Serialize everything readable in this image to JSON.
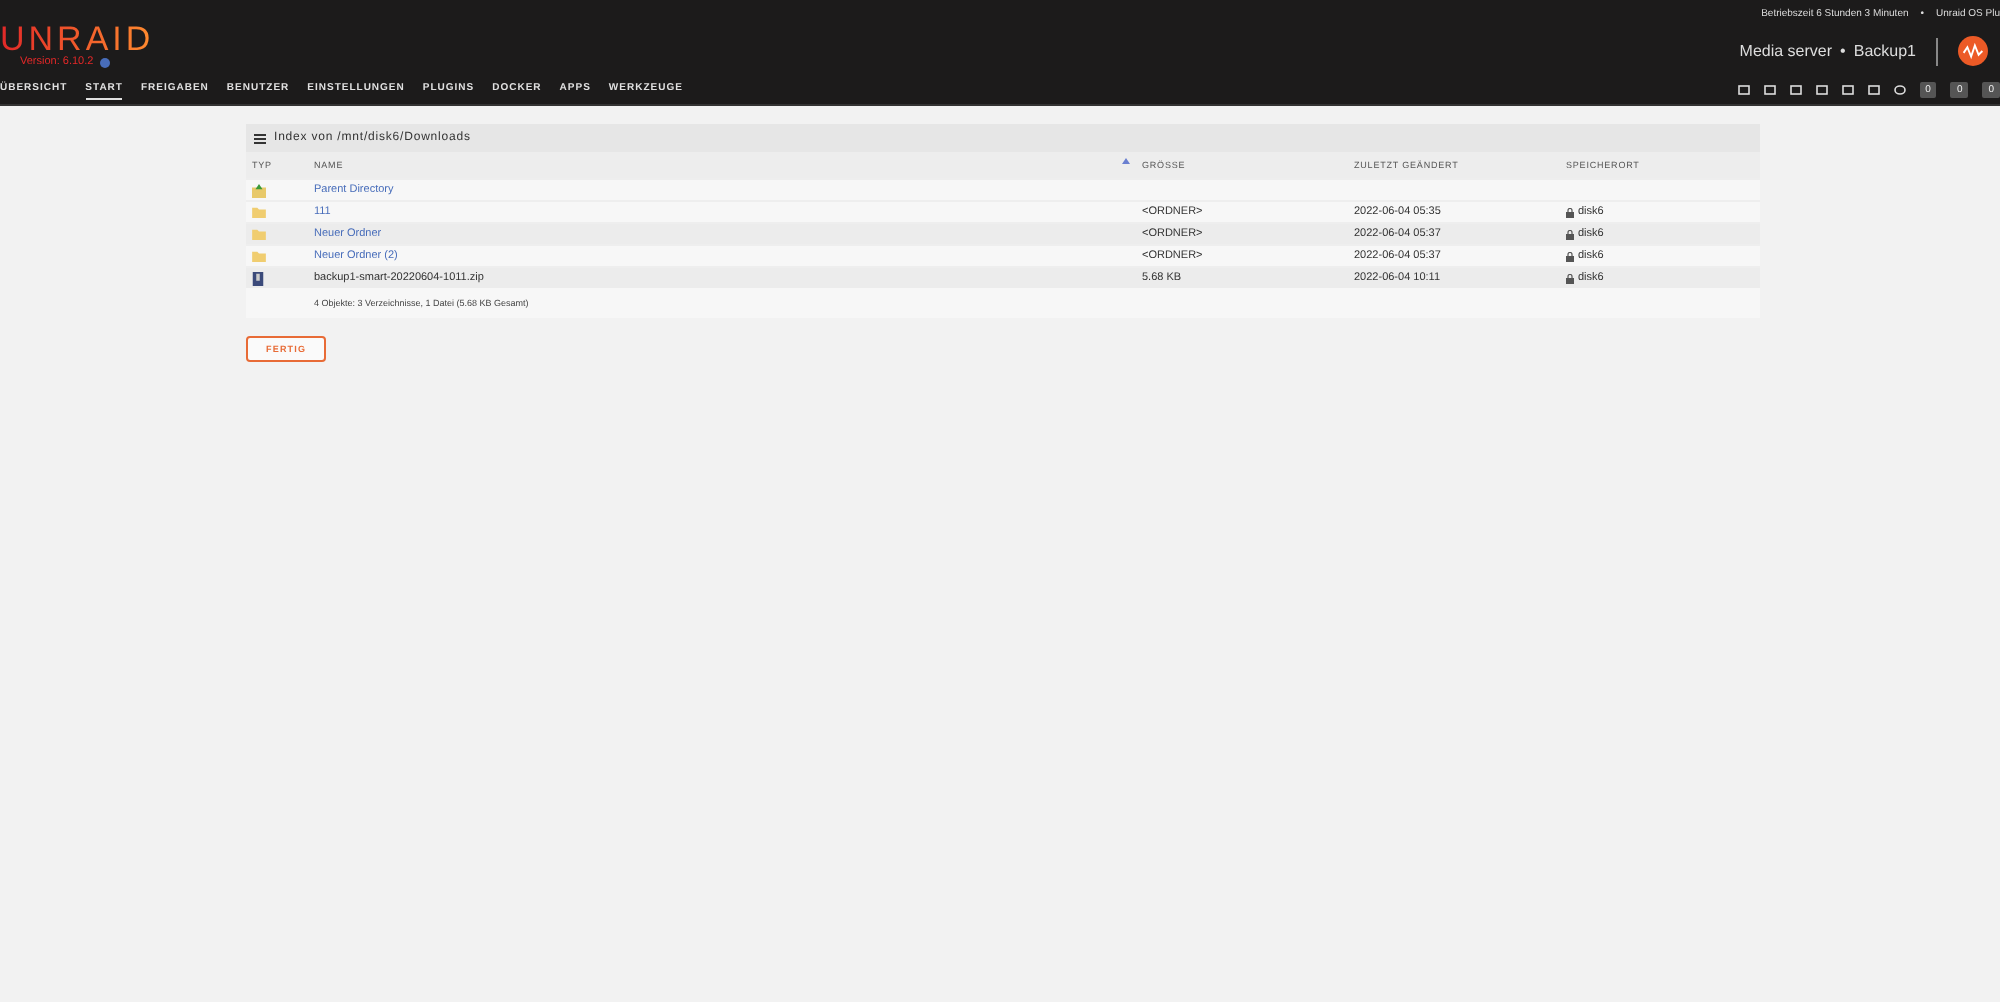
{
  "header": {
    "logo": "UNRAID",
    "version": "Version: 6.10.2",
    "status": [
      "Betriebszeit 6 Stunden 3 Minuten",
      "•",
      "Unraid OS Plu"
    ],
    "server": "Media server",
    "separator": "•",
    "name": "Backup1",
    "counters": [
      "0",
      "0",
      "0"
    ]
  },
  "nav": [
    {
      "label": "ÜBERSICHT",
      "selected": false
    },
    {
      "label": "START",
      "selected": true
    },
    {
      "label": "FREIGABEN",
      "selected": false
    },
    {
      "label": "BENUTZER",
      "selected": false
    },
    {
      "label": "EINSTELLUNGEN",
      "selected": false
    },
    {
      "label": "PLUGINS",
      "selected": false
    },
    {
      "label": "DOCKER",
      "selected": false
    },
    {
      "label": "APPS",
      "selected": false
    },
    {
      "label": "WERKZEUGE",
      "selected": false
    }
  ],
  "panel": {
    "title": "Index von /mnt/disk6/Downloads",
    "columns": [
      "TYP",
      "NAME",
      "GRÖSSE",
      "ZULETZT GEÄNDERT",
      "SPEICHERORT"
    ],
    "rows": [
      {
        "kind": "parent",
        "name": "Parent Directory"
      },
      {
        "kind": "folder",
        "name": "111",
        "size": "<ORDNER>",
        "modified": "2022-06-04 05:35",
        "location": "disk6"
      },
      {
        "kind": "folder",
        "name": "Neuer Ordner",
        "size": "<ORDNER>",
        "modified": "2022-06-04 05:37",
        "location": "disk6"
      },
      {
        "kind": "folder",
        "name": "Neuer Ordner (2)",
        "size": "<ORDNER>",
        "modified": "2022-06-04 05:37",
        "location": "disk6"
      },
      {
        "kind": "file",
        "name": "backup1-smart-20220604-1011.zip",
        "size": "5.68 KB",
        "modified": "2022-06-04 10:11",
        "location": "disk6"
      }
    ],
    "summary": "4 Objekte: 3 Verzeichnisse, 1 Datei (5.68 KB Gesamt)"
  },
  "button": "FERTIG"
}
